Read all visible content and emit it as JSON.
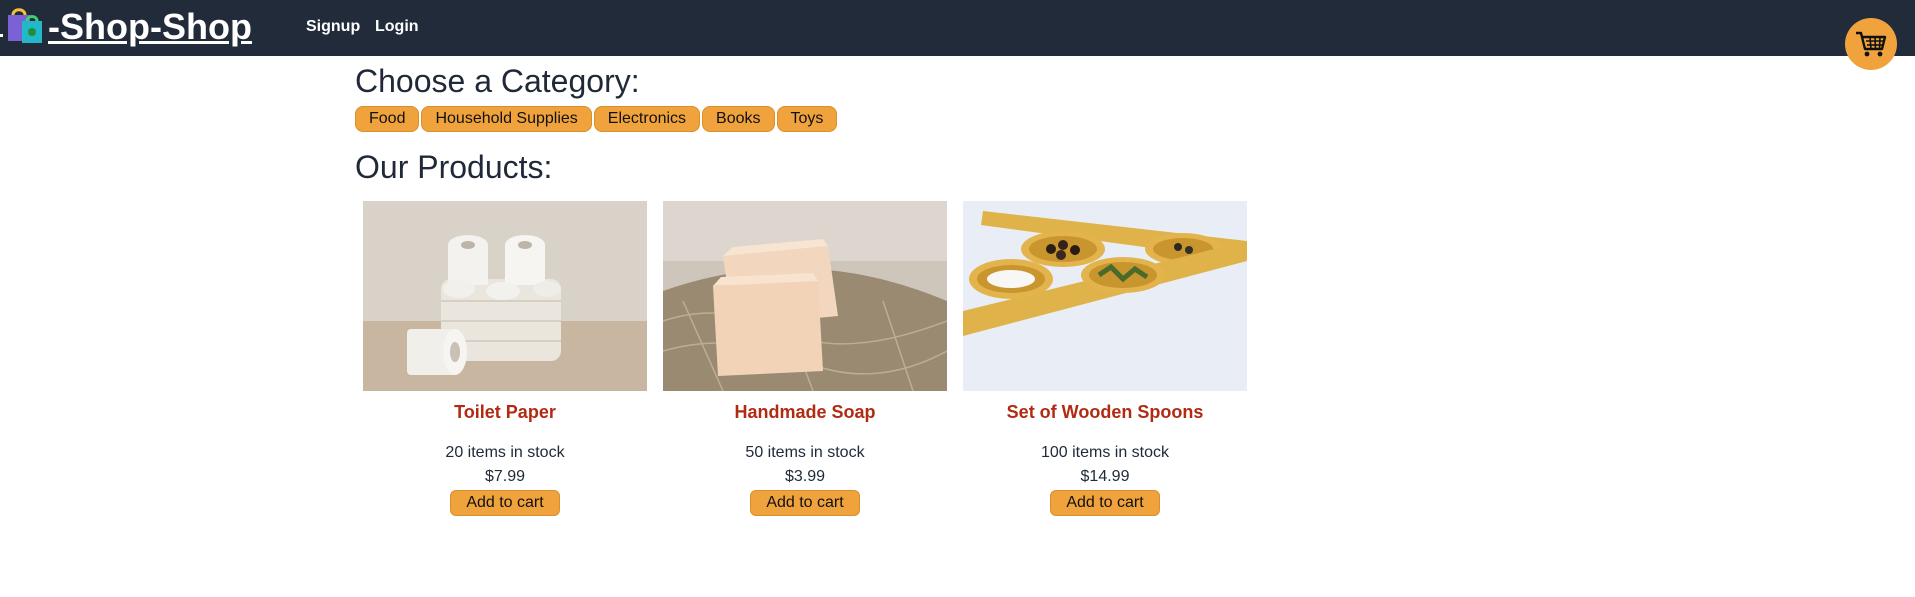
{
  "header": {
    "brand_text": "-Shop-Shop",
    "nav": {
      "signup": "Signup",
      "login": "Login"
    }
  },
  "categories_section": {
    "title": "Choose a Category:",
    "items": [
      "Food",
      "Household Supplies",
      "Electronics",
      "Books",
      "Toys"
    ]
  },
  "products_section": {
    "title": "Our Products:",
    "items": [
      {
        "name": "Toilet Paper",
        "stock": "20 items in stock",
        "price": "$7.99",
        "button": "Add to cart"
      },
      {
        "name": "Handmade Soap",
        "stock": "50 items in stock",
        "price": "$3.99",
        "button": "Add to cart"
      },
      {
        "name": "Set of Wooden Spoons",
        "stock": "100 items in stock",
        "price": "$14.99",
        "button": "Add to cart"
      }
    ]
  },
  "theme": {
    "header_bg": "#222b3a",
    "accent": "#f0a33d",
    "product_name": "#b22a12"
  },
  "icons": {
    "cart": "shopping-cart-icon",
    "logo": "shopping-bags-logo"
  }
}
